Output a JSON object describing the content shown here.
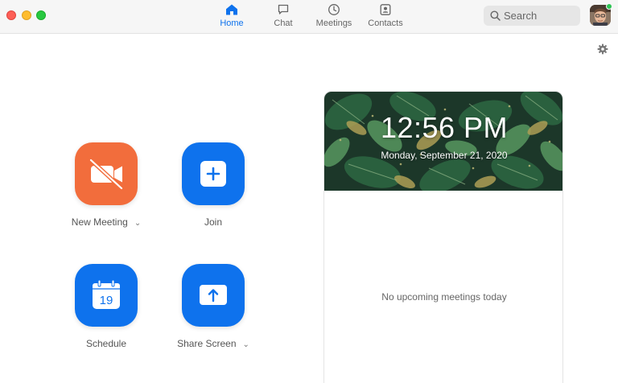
{
  "window": {
    "traffic_lights": [
      "close",
      "minimize",
      "maximize"
    ],
    "colors": {
      "close": "#fd5f57",
      "minimize": "#febc2e",
      "maximize": "#28c840"
    }
  },
  "nav": {
    "tabs": [
      {
        "label": "Home",
        "icon": "home-icon",
        "active": true
      },
      {
        "label": "Chat",
        "icon": "chat-bubble-icon",
        "active": false
      },
      {
        "label": "Meetings",
        "icon": "clock-icon",
        "active": false
      },
      {
        "label": "Contacts",
        "icon": "contact-card-icon",
        "active": false
      }
    ],
    "accent": "#0e72ed"
  },
  "search": {
    "placeholder": "Search",
    "icon": "search-icon"
  },
  "profile": {
    "icon": "avatar",
    "status_icon": "presence-dot",
    "status_color": "#2cc453"
  },
  "settings": {
    "icon": "gear-icon"
  },
  "actions": [
    {
      "label": "New Meeting",
      "icon": "video-off-icon",
      "color": "#f26d3c",
      "has_dropdown": true
    },
    {
      "label": "Join",
      "icon": "plus-icon",
      "color": "#0e72ed",
      "has_dropdown": false
    },
    {
      "label": "Schedule",
      "icon": "calendar-icon",
      "icon_text": "19",
      "color": "#0e72ed",
      "has_dropdown": false
    },
    {
      "label": "Share Screen",
      "icon": "share-up-arrow-icon",
      "color": "#0e72ed",
      "has_dropdown": true
    }
  ],
  "calendar_panel": {
    "time": "12:56 PM",
    "date": "Monday, September 21, 2020",
    "empty_message": "No upcoming meetings today"
  }
}
